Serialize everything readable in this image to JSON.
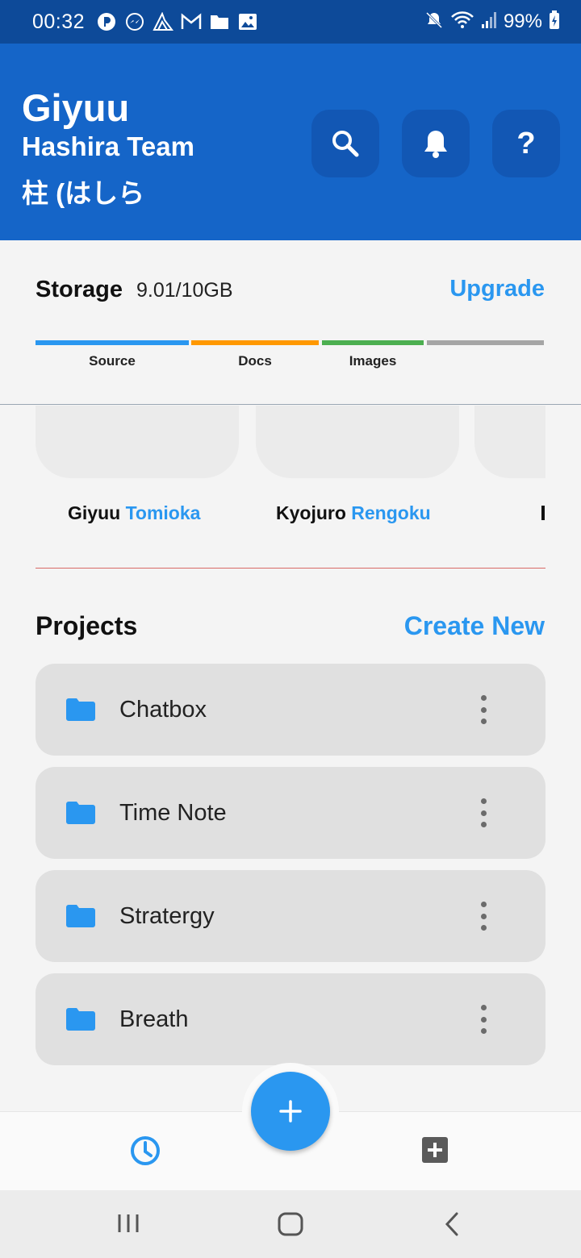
{
  "status_bar": {
    "time": "00:32",
    "battery_text": "99%",
    "left_icons": [
      "app-icon",
      "messenger-icon",
      "tool-icon",
      "gmail-icon",
      "folder-icon",
      "gallery-icon"
    ],
    "right_icons": [
      "mute-icon",
      "wifi-icon",
      "signal-icon",
      "battery-charging-icon"
    ]
  },
  "header": {
    "user_name": "Giyuu",
    "team_name": "Hashira Team",
    "team_sub": "柱 (はしら",
    "actions": [
      "search-icon",
      "bell-icon",
      "help-icon"
    ],
    "help_glyph": "?"
  },
  "storage": {
    "title": "Storage",
    "amount": "9.01/10GB",
    "upgrade_label": "Upgrade",
    "segments": [
      {
        "label": "Source",
        "color": "#2a97f0"
      },
      {
        "label": "Docs",
        "color": "#ff9800"
      },
      {
        "label": "Images",
        "color": "#4caf50"
      },
      {
        "label": "",
        "color": "#a5a5a5"
      }
    ]
  },
  "members": [
    {
      "first": "Giyuu",
      "last": "Tomioka"
    },
    {
      "first": "Kyojuro",
      "last": "Rengoku"
    },
    {
      "first": "",
      "last": ""
    }
  ],
  "projects": {
    "title": "Projects",
    "create_label": "Create New",
    "items": [
      {
        "name": "Chatbox"
      },
      {
        "name": "Time Note"
      },
      {
        "name": "Stratergy"
      },
      {
        "name": "Breath"
      }
    ]
  },
  "bottom_nav": {
    "items": [
      "clock-icon",
      "add-box-icon"
    ],
    "fab_icon": "plus-icon"
  },
  "colors": {
    "primary": "#1565c8",
    "accent": "#2a97f0",
    "status_bar": "#0d4a99"
  }
}
